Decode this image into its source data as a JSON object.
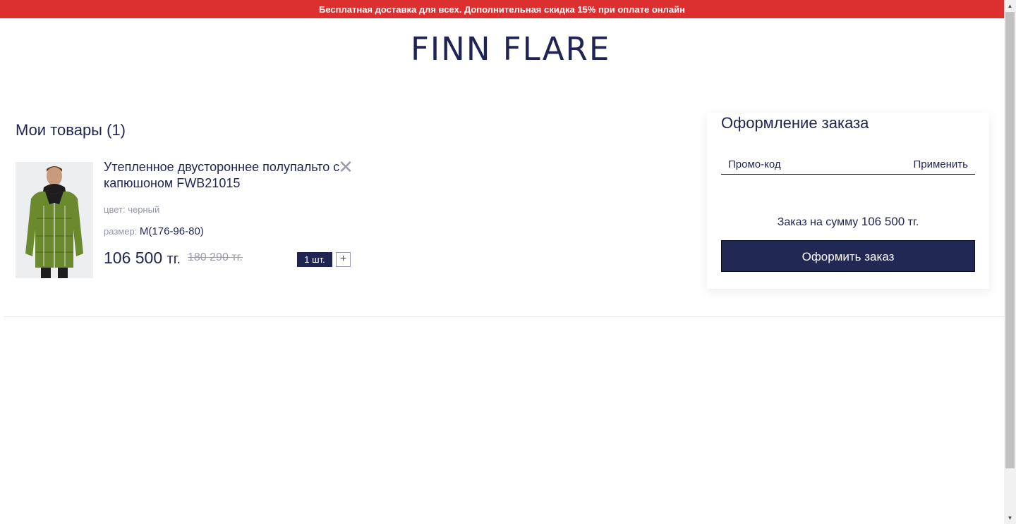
{
  "banner": {
    "text": "Бесплатная доставка для всех. Дополнительная скидка 15% при оплате онлайн"
  },
  "logo": {
    "text": "FINN FLARE"
  },
  "cart": {
    "title": "Мои товары (1)",
    "items": [
      {
        "name": "Утепленное двустороннее полупальто с капюшоном FWB21015",
        "color_label": "цвет:",
        "color_value": "черный",
        "size_label": "размер:",
        "size_value": "M(176-96-80)",
        "price": "106 500",
        "currency": "тг.",
        "old_price": "180 290 тг.",
        "quantity": "1 шт.",
        "plus_label": "+",
        "remove_label": "✕"
      }
    ]
  },
  "order": {
    "title": "Оформление заказа",
    "promo_placeholder": "Промо-код",
    "apply_label": "Применить",
    "sum_prefix": "Заказ на сумму",
    "sum_value": "106 500",
    "sum_currency": "тг.",
    "checkout_label": "Оформить заказ"
  },
  "colors": {
    "brand": "#1f2453",
    "banner": "#dc3030",
    "muted": "#9094a8"
  },
  "icons": {
    "remove": "close-icon",
    "increase": "plus-icon"
  }
}
